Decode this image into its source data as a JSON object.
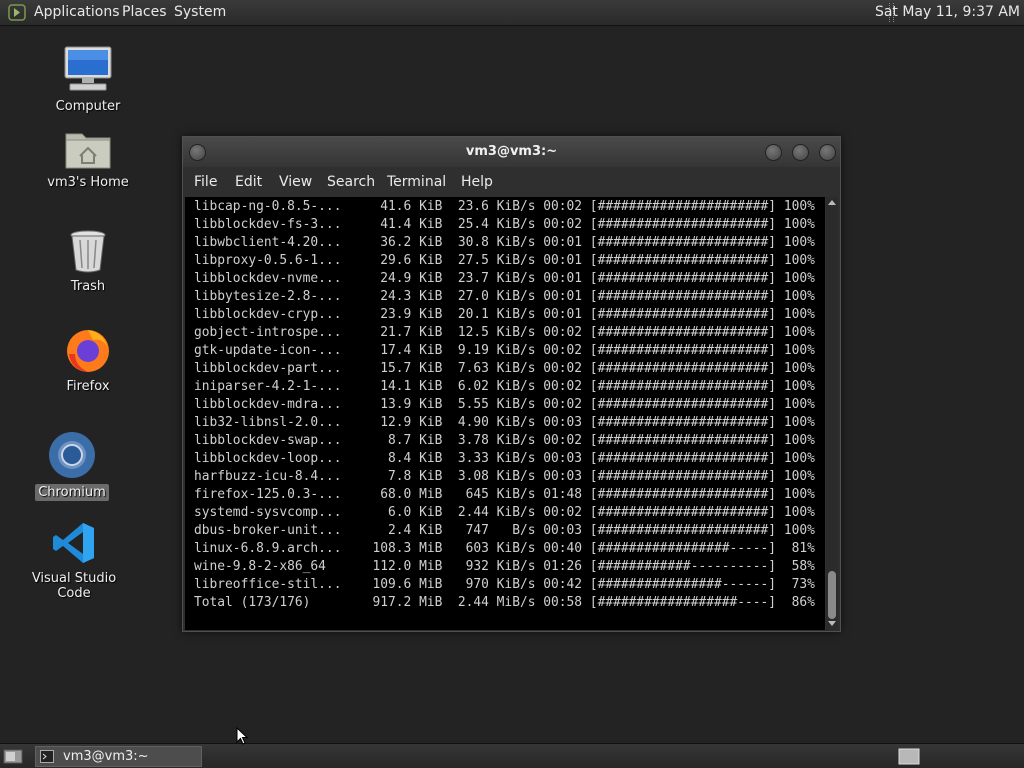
{
  "top_panel": {
    "menus": [
      "Applications",
      "Places",
      "System"
    ],
    "clock": "Sat May 11,  9:37 AM"
  },
  "desktop": {
    "icons": [
      {
        "label": "Computer",
        "icon": "computer-icon"
      },
      {
        "label": "vm3's Home",
        "icon": "home-folder-icon"
      },
      {
        "label": "Trash",
        "icon": "trash-icon"
      },
      {
        "label": "Firefox",
        "icon": "firefox-icon"
      },
      {
        "label": "Chromium",
        "icon": "chromium-icon",
        "selected": true
      },
      {
        "label": "Visual Studio Code",
        "icon": "vscode-icon"
      }
    ]
  },
  "terminal": {
    "title": "vm3@vm3:~",
    "menu": [
      "File",
      "Edit",
      "View",
      "Search",
      "Terminal",
      "Help"
    ],
    "lines": [
      "libcap-ng-0.8.5-...     41.6 KiB  23.6 KiB/s 00:02 [######################] 100%",
      "libblockdev-fs-3...     41.4 KiB  25.4 KiB/s 00:02 [######################] 100%",
      "libwbclient-4.20...     36.2 KiB  30.8 KiB/s 00:01 [######################] 100%",
      "libproxy-0.5.6-1...     29.6 KiB  27.5 KiB/s 00:01 [######################] 100%",
      "libblockdev-nvme...     24.9 KiB  23.7 KiB/s 00:01 [######################] 100%",
      "libbytesize-2.8-...     24.3 KiB  27.0 KiB/s 00:01 [######################] 100%",
      "libblockdev-cryp...     23.9 KiB  20.1 KiB/s 00:01 [######################] 100%",
      "gobject-introspe...     21.7 KiB  12.5 KiB/s 00:02 [######################] 100%",
      "gtk-update-icon-...     17.4 KiB  9.19 KiB/s 00:02 [######################] 100%",
      "libblockdev-part...     15.7 KiB  7.63 KiB/s 00:02 [######################] 100%",
      "iniparser-4.2-1-...     14.1 KiB  6.02 KiB/s 00:02 [######################] 100%",
      "libblockdev-mdra...     13.9 KiB  5.55 KiB/s 00:02 [######################] 100%",
      "lib32-libnsl-2.0...     12.9 KiB  4.90 KiB/s 00:03 [######################] 100%",
      "libblockdev-swap...      8.7 KiB  3.78 KiB/s 00:02 [######################] 100%",
      "libblockdev-loop...      8.4 KiB  3.33 KiB/s 00:03 [######################] 100%",
      "harfbuzz-icu-8.4...      7.8 KiB  3.08 KiB/s 00:03 [######################] 100%",
      "firefox-125.0.3-...     68.0 MiB   645 KiB/s 01:48 [######################] 100%",
      "systemd-sysvcomp...      6.0 KiB  2.44 KiB/s 00:02 [######################] 100%",
      "dbus-broker-unit...      2.4 KiB   747   B/s 00:03 [######################] 100%",
      "linux-6.8.9.arch...    108.3 MiB   603 KiB/s 00:40 [#################-----]  81%",
      "wine-9.8-2-x86_64      112.0 MiB   932 KiB/s 01:26 [############----------]  58%",
      "libreoffice-stil...    109.6 MiB   970 KiB/s 00:42 [################------]  73%",
      "Total (173/176)        917.2 MiB  2.44 MiB/s 00:58 [##################----]  86%"
    ]
  },
  "taskbar": {
    "window_button": "vm3@vm3:~"
  }
}
